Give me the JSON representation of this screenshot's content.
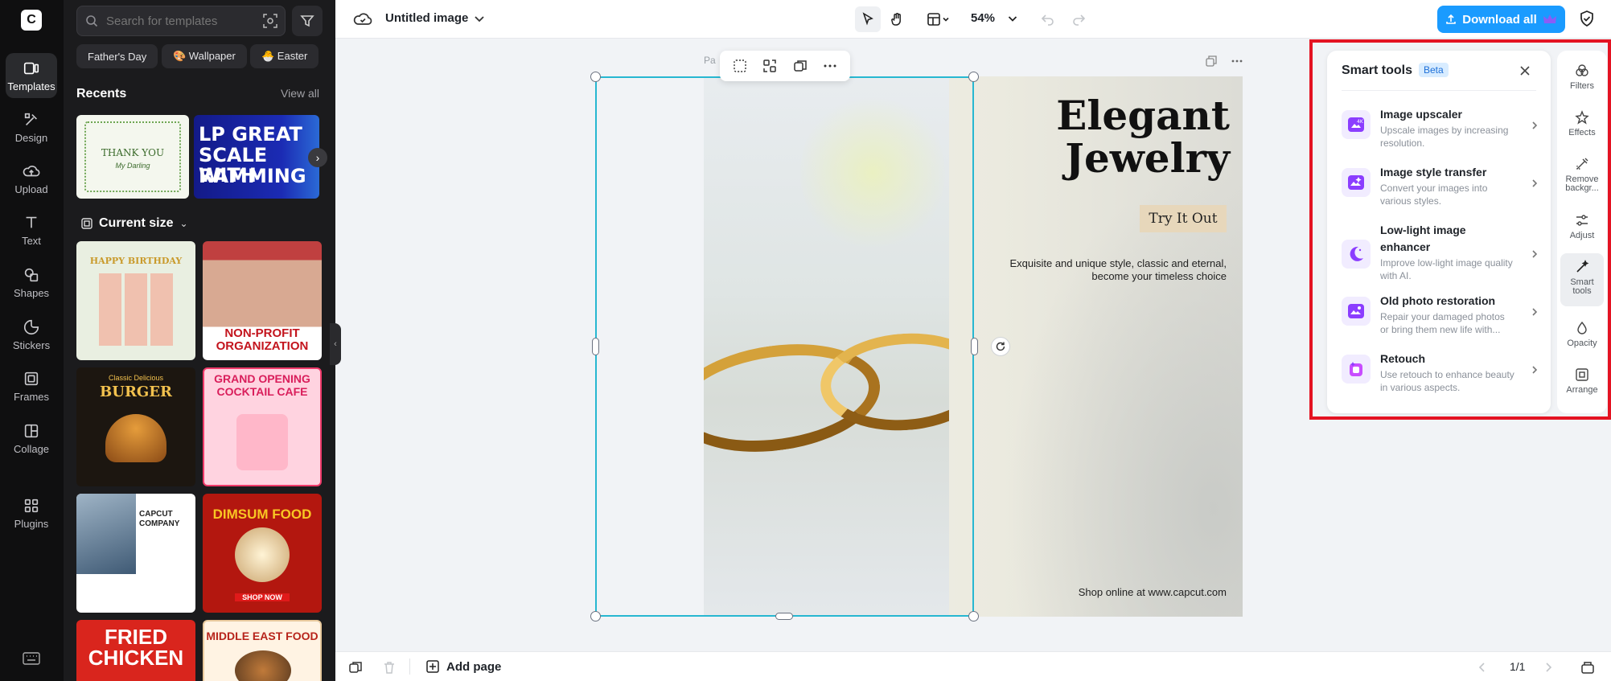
{
  "rail": {
    "logo": "C",
    "items": [
      {
        "label": "Templates",
        "icon": "templates-icon"
      },
      {
        "label": "Design",
        "icon": "design-icon"
      },
      {
        "label": "Upload",
        "icon": "upload-icon"
      },
      {
        "label": "Text",
        "icon": "text-icon"
      },
      {
        "label": "Shapes",
        "icon": "shapes-icon"
      },
      {
        "label": "Stickers",
        "icon": "stickers-icon"
      },
      {
        "label": "Frames",
        "icon": "frames-icon"
      },
      {
        "label": "Collage",
        "icon": "collage-icon"
      },
      {
        "label": "Plugins",
        "icon": "plugins-icon"
      }
    ]
  },
  "panel": {
    "search_placeholder": "Search for templates",
    "chips": [
      "Father's Day",
      "🎨 Wallpaper",
      "🐣 Easter"
    ],
    "recents_title": "Recents",
    "view_all": "View all",
    "recent_1": {
      "title": "THANK YOU",
      "subtitle": "My Darling"
    },
    "recent_2": {
      "lines": [
        "LP GREAT",
        "SCALE WITH",
        "RAMMING"
      ]
    },
    "current_size": "Current size",
    "templates": [
      {
        "title": "HAPPY BIRTHDAY",
        "sub": ""
      },
      {
        "title": "NON-PROFIT",
        "sub": "ORGANIZATION"
      },
      {
        "title": "BURGER",
        "sub": "Classic Delicious"
      },
      {
        "title": "GRAND OPENING",
        "sub": "COCKTAIL CAFE"
      },
      {
        "title": "CAPCUT",
        "sub": "COMPANY"
      },
      {
        "title": "DIMSUM FOOD",
        "sub": "SHOP NOW"
      },
      {
        "title": "FRIED",
        "sub": "CHICKEN"
      },
      {
        "title": "MIDDLE EAST FOOD",
        "sub": ""
      }
    ]
  },
  "topbar": {
    "title": "Untitled image",
    "zoom": "54%",
    "download": "Download all"
  },
  "canvas": {
    "page_label": "Pa",
    "headline_1": "Elegant",
    "headline_2": "Jewelry",
    "cta": "Try It Out",
    "tagline": "Exquisite and unique style, classic and eternal, become your timeless choice",
    "shop": "Shop online at www.capcut.com"
  },
  "smart_tools": {
    "title": "Smart tools",
    "badge": "Beta",
    "tools": [
      {
        "name": "Image upscaler",
        "desc": "Upscale images by increasing resolution.",
        "icon": "upscale-icon"
      },
      {
        "name": "Image style transfer",
        "desc": "Convert your images into various styles.",
        "icon": "style-transfer-icon"
      },
      {
        "name": "Low-light image enhancer",
        "desc": "Improve low-light image quality with AI.",
        "icon": "moon-icon"
      },
      {
        "name": "Old photo restoration",
        "desc": "Repair your damaged photos or bring them new life with...",
        "icon": "photo-restore-icon"
      },
      {
        "name": "Retouch",
        "desc": "Use retouch to enhance beauty in various aspects.",
        "icon": "retouch-icon"
      }
    ]
  },
  "right_rail": [
    {
      "label": "Filters",
      "icon": "filters-icon"
    },
    {
      "label": "Effects",
      "icon": "effects-icon"
    },
    {
      "label": "Remove backgr...",
      "icon": "remove-bg-icon"
    },
    {
      "label": "Adjust",
      "icon": "adjust-icon"
    },
    {
      "label": "Smart tools",
      "icon": "magic-wand-icon"
    },
    {
      "label": "Opacity",
      "icon": "opacity-icon"
    },
    {
      "label": "Arrange",
      "icon": "arrange-icon"
    }
  ],
  "bottombar": {
    "add_page": "Add page",
    "pager": "1/1"
  },
  "colors": {
    "accent": "#1a9bff",
    "selection": "#27b7d1",
    "highlight": "#e41322",
    "smart_icon": "#8b3dff"
  }
}
